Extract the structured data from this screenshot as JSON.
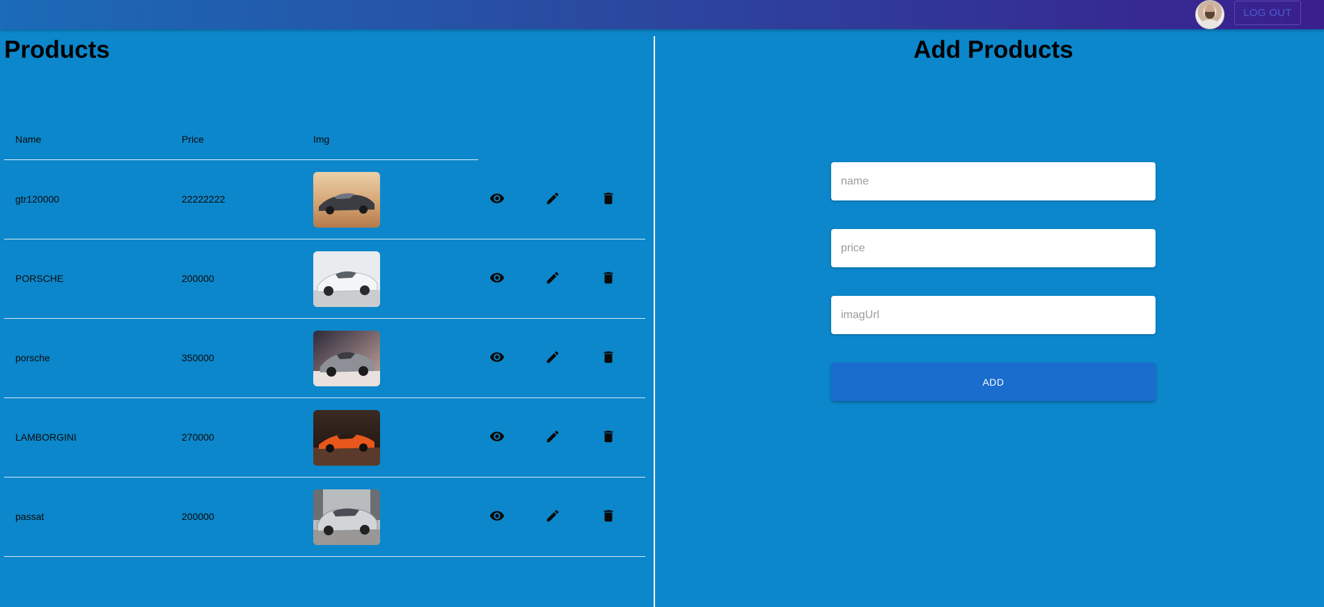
{
  "header": {
    "logout_label": "LOG OUT",
    "avatar_alt": "user avatar"
  },
  "products": {
    "title": "Products",
    "columns": [
      "Name",
      "Price",
      "Img"
    ],
    "rows": [
      {
        "name": "gtr120000",
        "price": "22222222",
        "image": "car-dark-sports-desert"
      },
      {
        "name": "PORSCHE",
        "price": "200000",
        "image": "car-white-sedan"
      },
      {
        "name": "porsche",
        "price": "350000",
        "image": "car-grey-sports"
      },
      {
        "name": "LAMBORGINI",
        "price": "270000",
        "image": "car-orange-supercar"
      },
      {
        "name": "passat",
        "price": "200000",
        "image": "car-silver-suv"
      }
    ],
    "actions": [
      "eye-icon",
      "pencil-icon",
      "trash-icon"
    ]
  },
  "add_form": {
    "title": "Add Products",
    "name_placeholder": "name",
    "price_placeholder": "price",
    "image_placeholder": "imagUrl",
    "add_label": "ADD"
  },
  "colors": {
    "background": "#0c87cb",
    "header_start": "#1b6bb8",
    "header_end": "#3a1f8c",
    "add_button": "#1a6ccd"
  }
}
